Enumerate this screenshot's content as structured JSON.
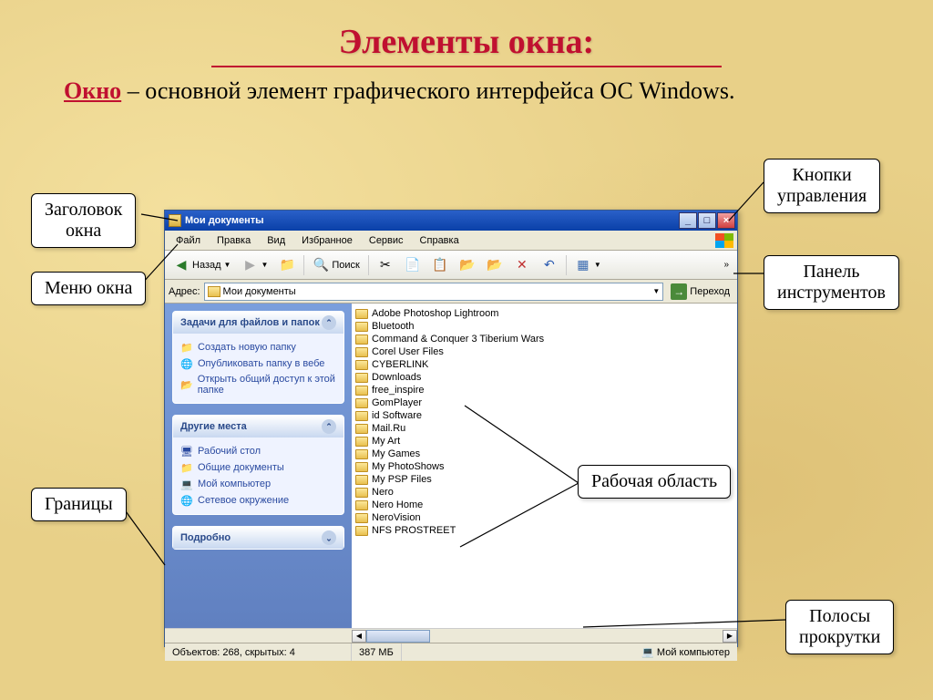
{
  "slide": {
    "title": "Элементы окна:",
    "keyword": "Окно",
    "text_rest": " – основной элемент графического интерфейса ОС Windows."
  },
  "callouts": {
    "title_bar": "Заголовок\nокна",
    "menu_bar": "Меню окна",
    "borders": "Границы",
    "control_buttons": "Кнопки\nуправления",
    "toolbar": "Панель\nинструментов",
    "work_area": "Рабочая область",
    "scrollbars": "Полосы\nпрокрутки"
  },
  "window": {
    "title": "Мои документы",
    "menu": [
      "Файл",
      "Правка",
      "Вид",
      "Избранное",
      "Сервис",
      "Справка"
    ],
    "toolbar": {
      "back": "Назад",
      "search": "Поиск"
    },
    "address_label": "Адрес:",
    "address_value": "Мои документы",
    "go_label": "Переход",
    "side": {
      "tasks_title": "Задачи для файлов и папок",
      "tasks": [
        "Создать новую папку",
        "Опубликовать папку в вебе",
        "Открыть общий доступ к этой папке"
      ],
      "places_title": "Другие места",
      "places": [
        "Рабочий стол",
        "Общие документы",
        "Мой компьютер",
        "Сетевое окружение"
      ],
      "details_title": "Подробно"
    },
    "files": [
      "Adobe Photoshop Lightroom",
      "Bluetooth",
      "Command & Conquer 3 Tiberium Wars",
      "Corel User Files",
      "CYBERLINK",
      "Downloads",
      "free_inspire",
      "GomPlayer",
      "id Software",
      "Mail.Ru",
      "My Art",
      "My Games",
      "My PhotoShows",
      "My PSP Files",
      "Nero",
      "Nero Home",
      "NeroVision",
      "NFS PROSTREET"
    ],
    "status": {
      "objects": "Объектов: 268, скрытых: 4",
      "size": "387 МБ",
      "location": "Мой компьютер"
    }
  }
}
